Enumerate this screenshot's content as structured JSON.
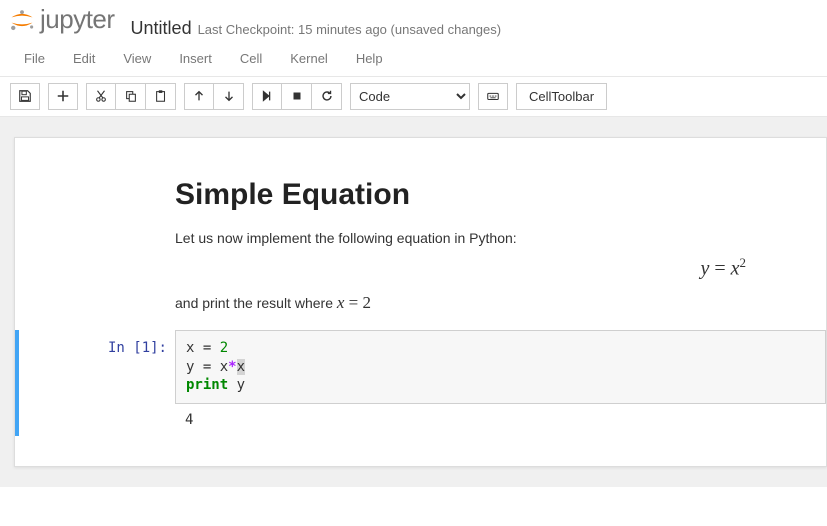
{
  "header": {
    "brand": "jupyter",
    "title": "Untitled",
    "checkpoint": "Last Checkpoint: 15 minutes ago (unsaved changes)"
  },
  "menu": {
    "items": [
      "File",
      "Edit",
      "View",
      "Insert",
      "Cell",
      "Kernel",
      "Help"
    ]
  },
  "toolbar": {
    "cell_type_selected": "Code",
    "cell_toolbar_label": "CellToolbar"
  },
  "notebook": {
    "markdown": {
      "heading": "Simple Equation",
      "p1": "Let us now implement the following equation in Python:",
      "equation_display": "y = x²",
      "p2_prefix": "and print the result where ",
      "p2_eq": "x = 2"
    },
    "code_cell": {
      "prompt": "In [1]:",
      "lines": [
        {
          "raw": "x = 2",
          "t": [
            [
              "x ",
              "plain"
            ],
            [
              "=",
              "op-plain"
            ],
            [
              " ",
              "plain"
            ],
            [
              "2",
              "num"
            ]
          ]
        },
        {
          "raw": "y = x*x",
          "t": [
            [
              "y ",
              "plain"
            ],
            [
              "=",
              "op-plain"
            ],
            [
              " x",
              "plain"
            ],
            [
              "*",
              "op"
            ],
            [
              "x",
              "hl"
            ]
          ]
        },
        {
          "raw": "print y",
          "t": [
            [
              "print",
              "kw"
            ],
            [
              " y",
              "plain"
            ]
          ]
        }
      ],
      "output": "4"
    }
  }
}
